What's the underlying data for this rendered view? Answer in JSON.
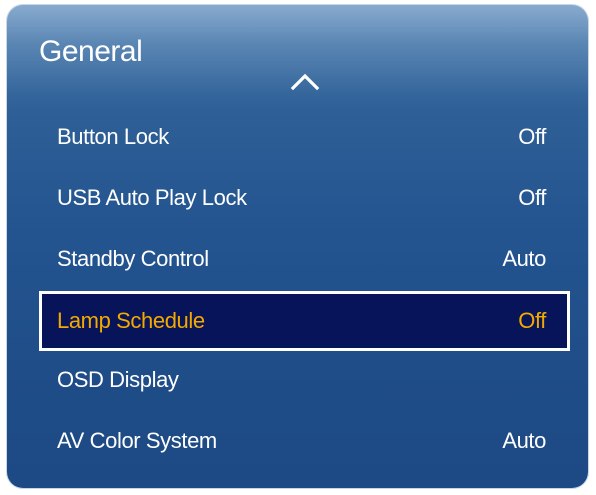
{
  "menu": {
    "title": "General",
    "scroll_up_icon": "chevron-up-icon",
    "items": [
      {
        "label": "Button Lock",
        "value": "Off"
      },
      {
        "label": "USB Auto Play Lock",
        "value": "Off"
      },
      {
        "label": "Standby Control",
        "value": "Auto"
      },
      {
        "label": "Lamp Schedule",
        "value": "Off",
        "selected": true
      },
      {
        "label": "OSD Display",
        "value": ""
      },
      {
        "label": "AV Color System",
        "value": "Auto"
      }
    ]
  },
  "colors": {
    "panel_blue": "#245590",
    "selected_bg": "#08145a",
    "selected_text": "#f2a900",
    "text": "#ffffff"
  }
}
